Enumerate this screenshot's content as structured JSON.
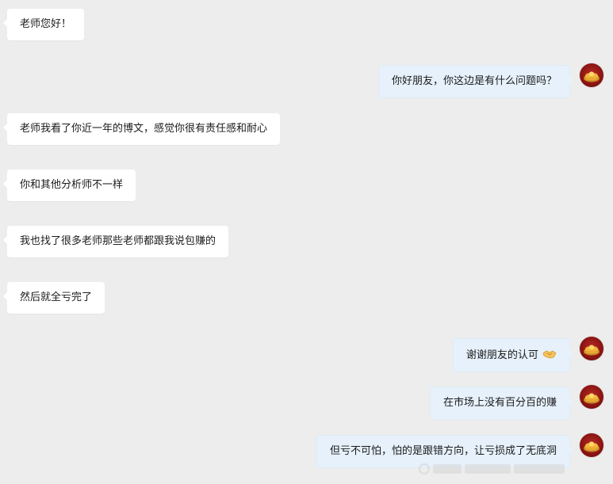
{
  "chat": {
    "messages": [
      {
        "side": "incoming",
        "text": "老师您好！"
      },
      {
        "side": "outgoing",
        "text": "你好朋友，你这边是有什么问题吗？"
      },
      {
        "side": "incoming",
        "text": "老师我看了你近一年的博文，感觉你很有责任感和耐心"
      },
      {
        "side": "incoming",
        "text": "你和其他分析师不一样"
      },
      {
        "side": "incoming",
        "text": "我也找了很多老师那些老师都跟我说包赚的"
      },
      {
        "side": "incoming",
        "text": "然后就全亏完了"
      },
      {
        "side": "outgoing",
        "text": "谢谢朋友的认可",
        "trailing_icon": "handshake-icon"
      },
      {
        "side": "outgoing",
        "text": "在市场上没有百分百的赚"
      },
      {
        "side": "outgoing",
        "text": "但亏不可怕，怕的是跟错方向，让亏损成了无底洞"
      }
    ]
  },
  "theme": {
    "background": "#ededed",
    "incoming_bubble": "#ffffff",
    "outgoing_bubble": "#e6f1fb",
    "text": "#1b1b1b",
    "avatar_red": "#8a1412",
    "avatar_gold": "#f0b73a"
  }
}
